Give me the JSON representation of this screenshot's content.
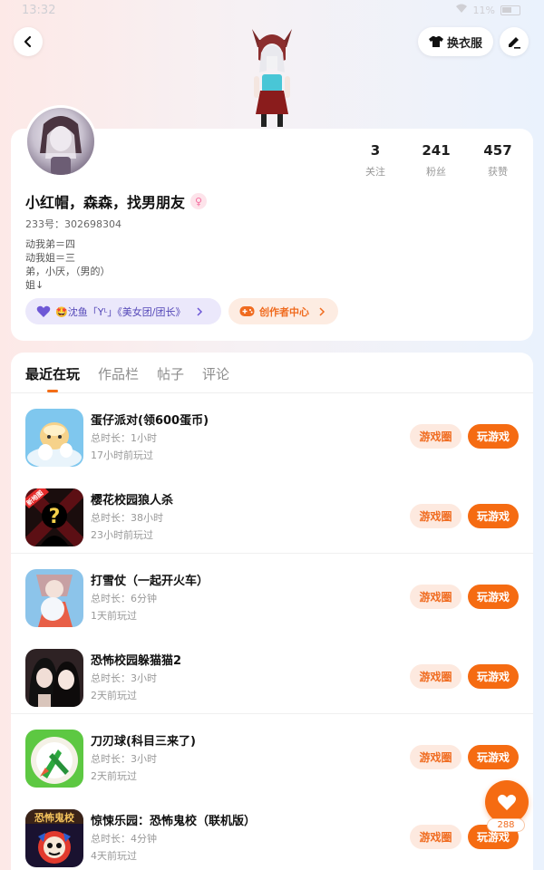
{
  "status_bar": {
    "time": "13:32",
    "battery": "11%"
  },
  "header": {
    "dress_up_label": "换衣服"
  },
  "profile": {
    "nickname": "小红帽，森森，找男朋友",
    "gender_symbol": "♀",
    "user_id": "233号：302698304",
    "bio_lines": [
      "动我弟＝四",
      "动我姐＝三",
      "弟，小厌，（男的）",
      "姐↓"
    ],
    "stats": [
      {
        "value": "3",
        "label": "关注"
      },
      {
        "value": "241",
        "label": "粉丝"
      },
      {
        "value": "457",
        "label": "获赞"
      }
    ],
    "guild_badge": "🤩沈鱼「Yᴸ」《美女团/团长》",
    "creator_badge": "创作者中心"
  },
  "tabs": [
    {
      "label": "最近在玩",
      "active": true
    },
    {
      "label": "作品栏",
      "active": false
    },
    {
      "label": "帖子",
      "active": false
    },
    {
      "label": "评论",
      "active": false
    }
  ],
  "games": [
    {
      "name": "蛋仔派对(领600蛋币)",
      "duration": "总时长：1小时",
      "last_played": "17小时前玩过",
      "circle_label": "游戏圈",
      "play_label": "玩游戏"
    },
    {
      "name": "樱花校园狼人杀",
      "duration": "总时长：38小时",
      "last_played": "23小时前玩过",
      "circle_label": "游戏圈",
      "play_label": "玩游戏",
      "icon_badge": "新地图"
    },
    {
      "name": "打雪仗（一起开火车）",
      "duration": "总时长：6分钟",
      "last_played": "1天前玩过",
      "circle_label": "游戏圈",
      "play_label": "玩游戏"
    },
    {
      "name": "恐怖校园躲猫猫2",
      "duration": "总时长：3小时",
      "last_played": "2天前玩过",
      "circle_label": "游戏圈",
      "play_label": "玩游戏"
    },
    {
      "name": "刀刃球(科目三来了)",
      "duration": "总时长：3小时",
      "last_played": "2天前玩过",
      "circle_label": "游戏圈",
      "play_label": "玩游戏"
    },
    {
      "name": "惊悚乐园：恐怖鬼校（联机版）",
      "duration": "总时长：4分钟",
      "last_played": "4天前玩过",
      "circle_label": "游戏圈",
      "play_label": "玩游戏",
      "icon_badge": "恐怖鬼校"
    }
  ],
  "like_fab": {
    "count": "288"
  },
  "colors": {
    "accent": "#f56b12",
    "accent_light": "#fde9df",
    "guild_bg": "#ebe8fb",
    "guild_text": "#5548b8"
  }
}
